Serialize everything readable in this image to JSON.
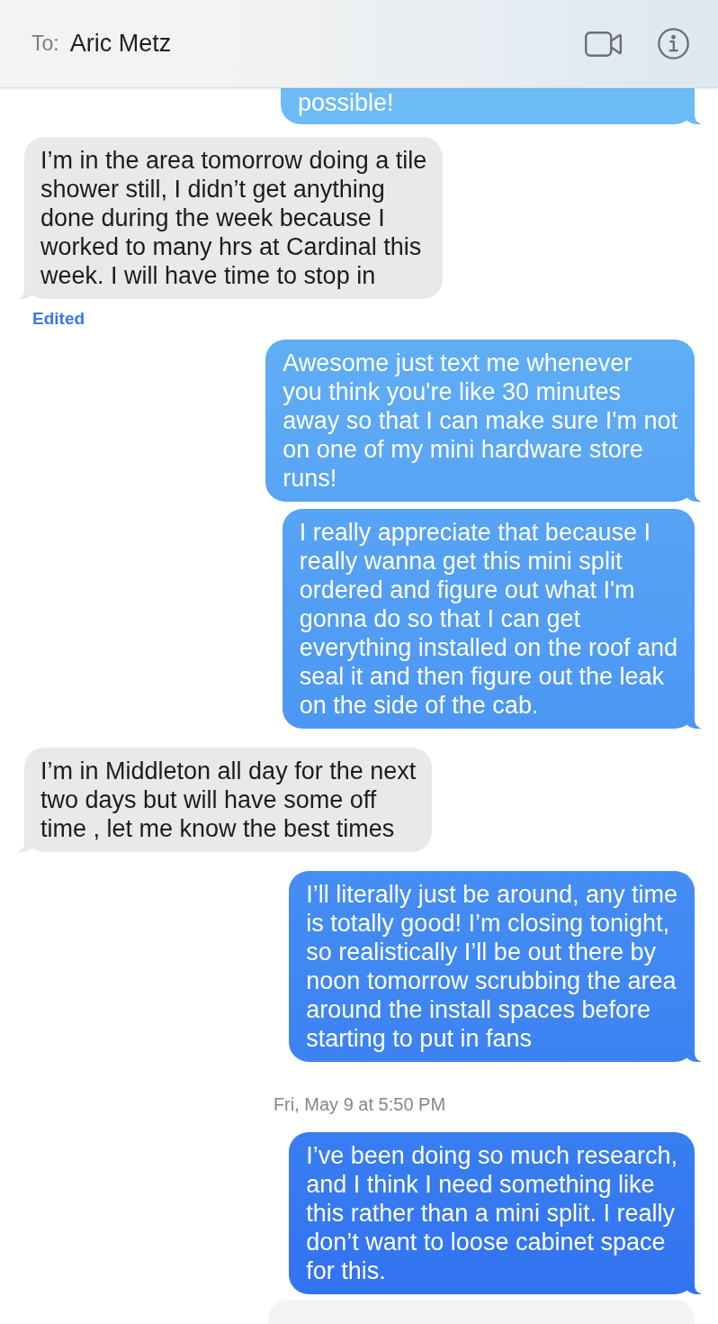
{
  "header": {
    "to_label": "To:",
    "recipient": "Aric Metz"
  },
  "partial_message": {
    "kind": "sent",
    "text": "possible!"
  },
  "messages": [
    {
      "kind": "received",
      "text": "I’m in the area tomorrow doing a tile\nshower still, I didn’t get anything\ndone during the week because I\nworked to many hrs at Cardinal this\nweek. I will have time to stop in",
      "note": "Edited"
    },
    {
      "kind": "sent",
      "text": "Awesome just text me whenever\nyou think you're like 30 minutes\naway so that I can make sure I'm not\non one of my mini hardware store\nruns!"
    },
    {
      "kind": "sent",
      "text": "I really appreciate that because I\nreally wanna get this mini split\nordered and figure out what I'm\ngonna do so that I can get\neverything installed on the roof and\nseal it and then figure out the leak\non the side of the cab."
    },
    {
      "kind": "received",
      "text": "I’m in Middleton all day for the next\ntwo days but will have some off\ntime , let me know the best times"
    },
    {
      "kind": "sent",
      "text": "I’ll literally just be around, any time\nis totally good! I’m closing tonight,\nso realistically I’ll be out there by\nnoon tomorrow scrubbing the area\naround the install spaces before\nstarting to put in fans"
    },
    {
      "kind": "timestamp",
      "text": "Fri, May 9 at 5:50 PM"
    },
    {
      "kind": "sent",
      "text": "I’ve been doing so much research,\nand I think I need something like\nthis rather than a mini split. I really\ndon’t want to loose cabinet space\nfor this."
    },
    {
      "kind": "attachment"
    }
  ]
}
